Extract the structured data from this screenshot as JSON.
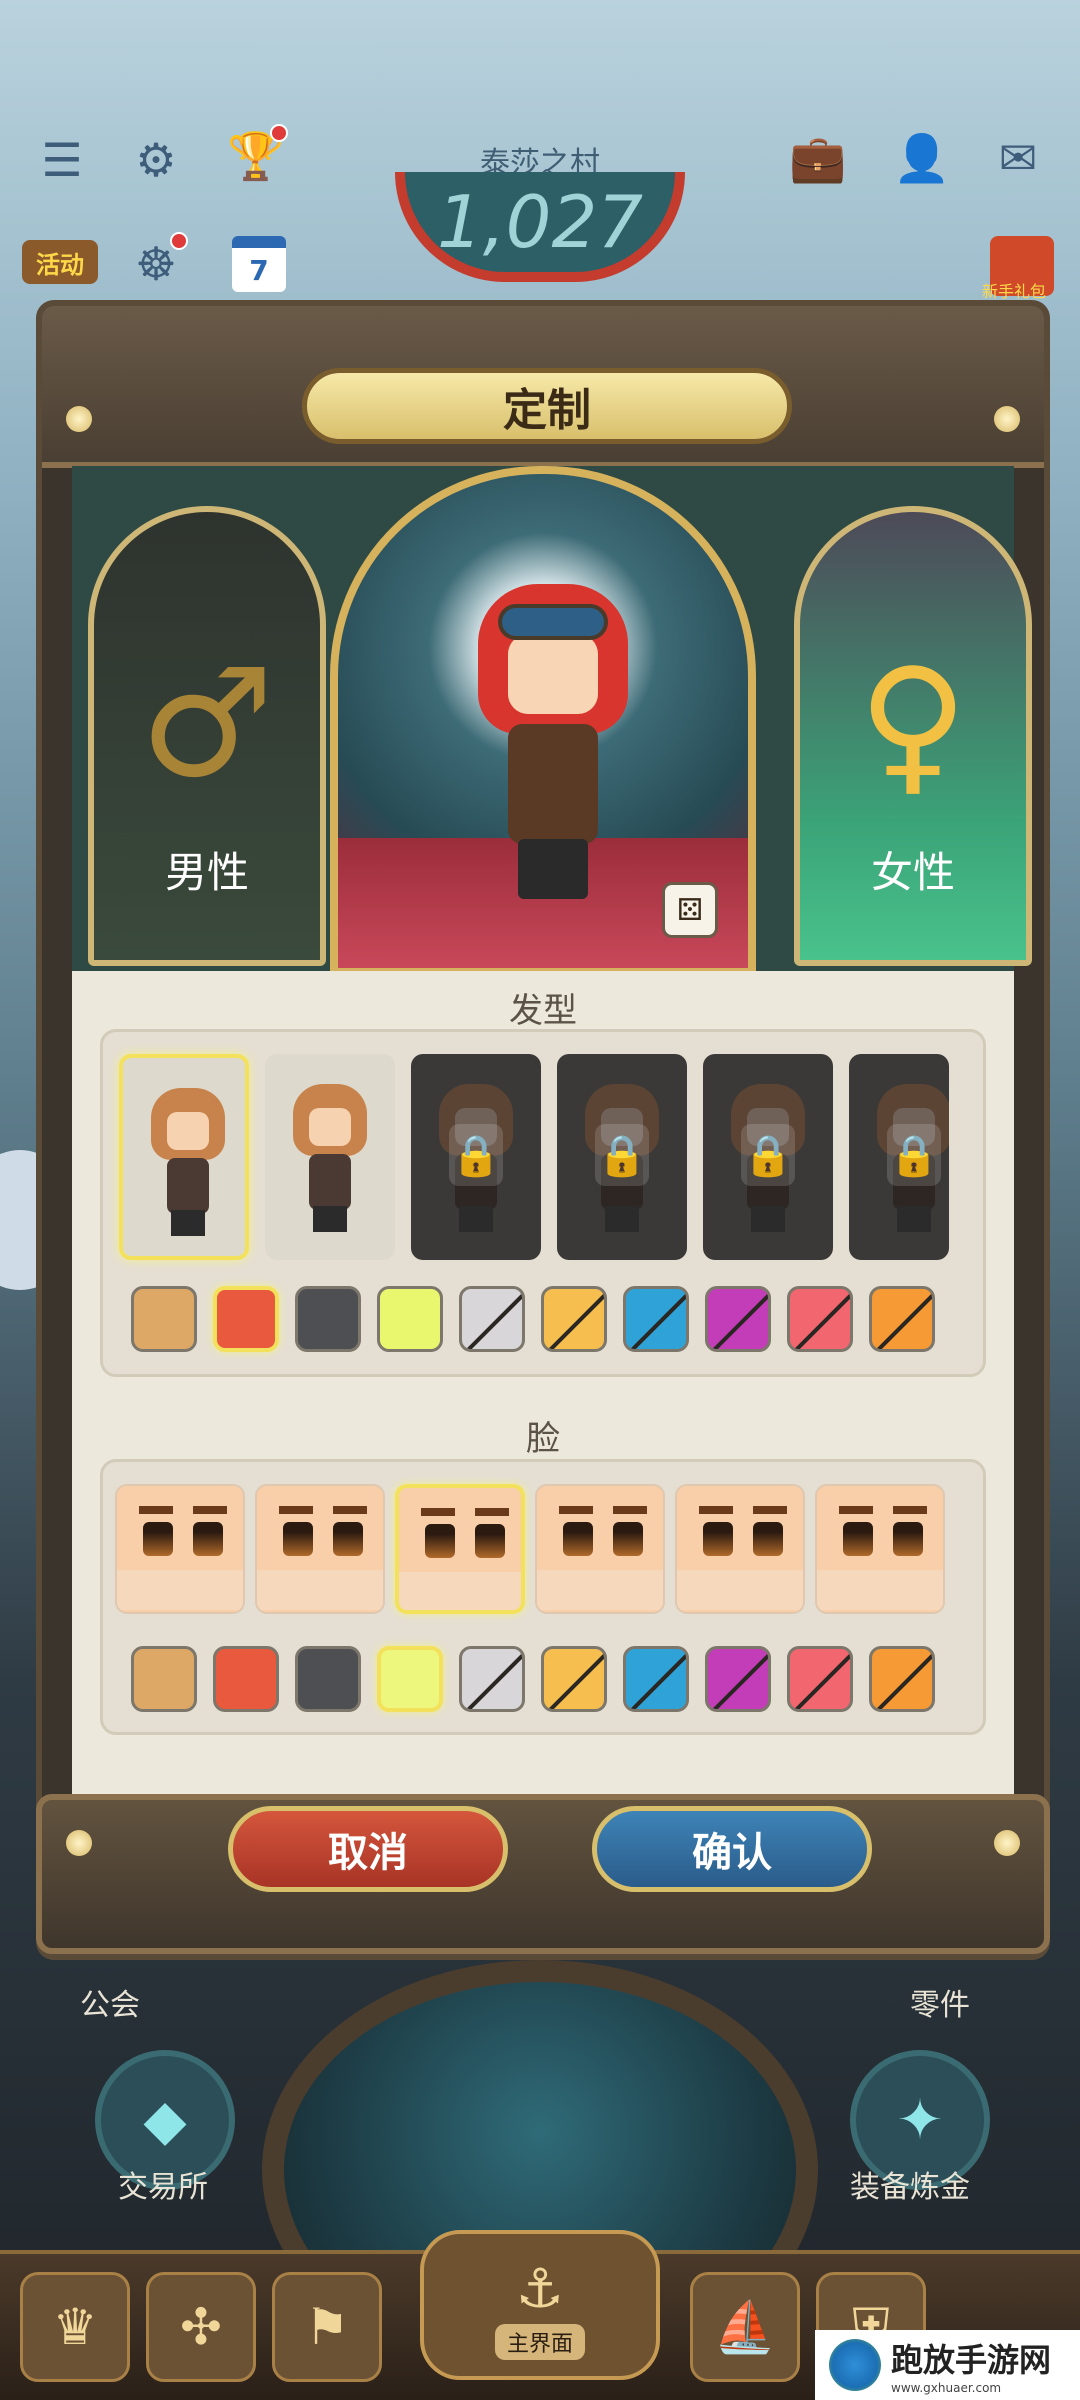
{
  "hud": {
    "village_name": "泰莎之村",
    "village_count": "1,027",
    "activity_label": "活动",
    "calendar_day": "7",
    "gift_label": "新手礼包"
  },
  "dialog": {
    "title": "定制",
    "gender_male_label": "男性",
    "gender_female_label": "女性",
    "gender_male_symbol": "♂",
    "gender_female_symbol": "♀",
    "dice_symbol": "⚄",
    "hair_section_title": "发型",
    "face_section_title": "脸",
    "cancel_label": "取消",
    "confirm_label": "确认"
  },
  "hair_styles": [
    {
      "state": "selected"
    },
    {
      "state": "unlocked"
    },
    {
      "state": "locked"
    },
    {
      "state": "locked"
    },
    {
      "state": "locked"
    },
    {
      "state": "locked"
    }
  ],
  "hair_colors": [
    {
      "color": "#dda865",
      "state": "available"
    },
    {
      "color": "#e8593e",
      "state": "selected"
    },
    {
      "color": "#4e4f52",
      "state": "available"
    },
    {
      "color": "#e9f76e",
      "state": "available"
    },
    {
      "color": "#d9d6d9",
      "state": "locked"
    },
    {
      "color": "#f6be4f",
      "state": "locked"
    },
    {
      "color": "#2fa3d8",
      "state": "locked"
    },
    {
      "color": "#c43db8",
      "state": "locked"
    },
    {
      "color": "#f26670",
      "state": "locked"
    },
    {
      "color": "#f59a34",
      "state": "locked"
    }
  ],
  "faces": [
    {
      "state": "available"
    },
    {
      "state": "available"
    },
    {
      "state": "selected"
    },
    {
      "state": "available"
    },
    {
      "state": "available"
    },
    {
      "state": "available"
    }
  ],
  "face_colors": [
    {
      "color": "#dda865",
      "state": "available"
    },
    {
      "color": "#e8593e",
      "state": "available"
    },
    {
      "color": "#4e4f52",
      "state": "available"
    },
    {
      "color": "#eef77d",
      "state": "selected"
    },
    {
      "color": "#d9d6d9",
      "state": "locked"
    },
    {
      "color": "#f6be4f",
      "state": "locked"
    },
    {
      "color": "#2fa3d8",
      "state": "locked"
    },
    {
      "color": "#c43db8",
      "state": "locked"
    },
    {
      "color": "#f26670",
      "state": "locked"
    },
    {
      "color": "#f59a34",
      "state": "locked"
    }
  ],
  "background": {
    "left_labels": [
      "公会",
      "交易所"
    ],
    "right_labels": [
      "零件",
      "装备炼金"
    ],
    "home_label": "主界面"
  },
  "watermark": {
    "name": "跑放手游网",
    "url": "www.gxhuaer.com"
  }
}
